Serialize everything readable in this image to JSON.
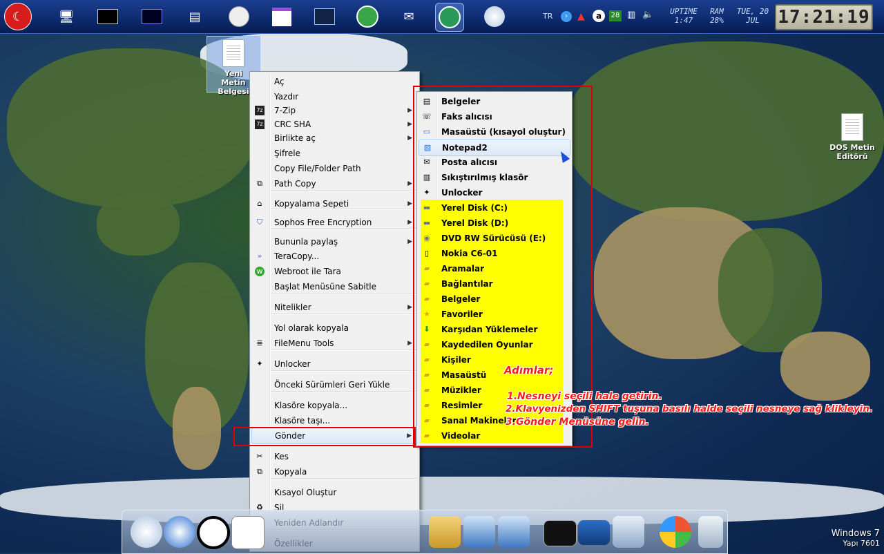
{
  "topbar": {
    "lang": "TR",
    "uptime_label": "UPTIME",
    "uptime_value": "1:47",
    "ram_label": "RAM",
    "ram_value": "28%",
    "date_line1": "TUE, 20",
    "date_line2": "JUL",
    "badge": "28",
    "clock": "17:21:19"
  },
  "desktop": {
    "selected_icon_label": "Yeni Metin Belgesi",
    "dos_icon_label": "DOS Metin Editörü"
  },
  "context_menu": {
    "items": [
      {
        "label": "Aç",
        "icon": "",
        "arrow": false
      },
      {
        "label": "Yazdır",
        "icon": "",
        "arrow": false
      },
      {
        "label": "7-Zip",
        "icon": "7z",
        "arrow": true
      },
      {
        "label": "CRC SHA",
        "icon": "7z",
        "arrow": true
      },
      {
        "label": "Birlikte aç",
        "icon": "",
        "arrow": true
      },
      {
        "label": "Şifrele",
        "icon": "",
        "arrow": false
      },
      {
        "label": "Copy File/Folder Path",
        "icon": "",
        "arrow": false
      },
      {
        "label": "Path Copy",
        "icon": "copy",
        "arrow": true
      },
      {
        "label": "Kopyalama Sepeti",
        "icon": "basket",
        "arrow": true
      },
      {
        "label": "Sophos Free Encryption",
        "icon": "shield",
        "arrow": true
      },
      {
        "label": "Bununla paylaş",
        "icon": "",
        "arrow": true
      },
      {
        "label": "TeraCopy...",
        "icon": "tera",
        "arrow": false
      },
      {
        "label": "Webroot ile Tara",
        "icon": "webroot",
        "arrow": false
      },
      {
        "label": "Başlat Menüsüne Sabitle",
        "icon": "",
        "arrow": false
      },
      {
        "label": "Nitelikler",
        "icon": "",
        "arrow": true
      },
      {
        "label": "Yol olarak kopyala",
        "icon": "",
        "arrow": false
      },
      {
        "label": "FileMenu Tools",
        "icon": "list",
        "arrow": true
      },
      {
        "label": "Unlocker",
        "icon": "wand",
        "arrow": false
      },
      {
        "label": "Önceki Sürümleri Geri Yükle",
        "icon": "",
        "arrow": false
      },
      {
        "label": "Klasöre kopyala...",
        "icon": "",
        "arrow": false
      },
      {
        "label": "Klasöre taşı...",
        "icon": "",
        "arrow": false
      },
      {
        "label": "Gönder",
        "icon": "",
        "arrow": true
      },
      {
        "label": "Kes",
        "icon": "scissors",
        "arrow": false
      },
      {
        "label": "Kopyala",
        "icon": "copy",
        "arrow": false
      },
      {
        "label": "Kısayol Oluştur",
        "icon": "",
        "arrow": false
      },
      {
        "label": "Sil",
        "icon": "recycle",
        "arrow": false
      },
      {
        "label": "Yeniden Adlandır",
        "icon": "rename",
        "arrow": false
      },
      {
        "label": "Özellikler",
        "icon": "props",
        "arrow": false
      }
    ]
  },
  "send_to_menu": {
    "items": [
      {
        "label": "Belgeler",
        "icon": "doc"
      },
      {
        "label": "Faks alıcısı",
        "icon": "fax"
      },
      {
        "label": "Masaüstü (kısayol oluştur)",
        "icon": "desktop"
      },
      {
        "label": "Notepad2",
        "icon": "notepad"
      },
      {
        "label": "Posta alıcısı",
        "icon": "mail"
      },
      {
        "label": "Sıkıştırılmış klasör",
        "icon": "zip"
      },
      {
        "label": "Unlocker",
        "icon": "wand"
      },
      {
        "label": "Yerel Disk (C:)",
        "icon": "drive"
      },
      {
        "label": "Yerel Disk (D:)",
        "icon": "drive"
      },
      {
        "label": "DVD RW Sürücüsü (E:)",
        "icon": "dvd"
      },
      {
        "label": "Nokia C6-01",
        "icon": "phone"
      },
      {
        "label": "Aramalar",
        "icon": "folder"
      },
      {
        "label": "Bağlantılar",
        "icon": "folder"
      },
      {
        "label": "Belgeler",
        "icon": "folder"
      },
      {
        "label": "Favoriler",
        "icon": "star"
      },
      {
        "label": "Karşıdan Yüklemeler",
        "icon": "download"
      },
      {
        "label": "Kaydedilen Oyunlar",
        "icon": "folder"
      },
      {
        "label": "Kişiler",
        "icon": "folder"
      },
      {
        "label": "Masaüstü",
        "icon": "folder"
      },
      {
        "label": "Müzikler",
        "icon": "folder"
      },
      {
        "label": "Resimler",
        "icon": "folder"
      },
      {
        "label": "Sanal Makineler",
        "icon": "folder"
      },
      {
        "label": "Videolar",
        "icon": "folder"
      }
    ]
  },
  "annotation": {
    "title": "Adımlar;",
    "step1": "1.Nesneyi seçili hale getirin.",
    "step2": "2.Klavyenizden SHIFT tuşuna basılı halde seçili nesneye sağ klikleyin.",
    "step3": "3.Gönder Menüsüne gelin."
  },
  "watermark": {
    "line1": "Windows 7",
    "line2": "Yapı 7601"
  }
}
